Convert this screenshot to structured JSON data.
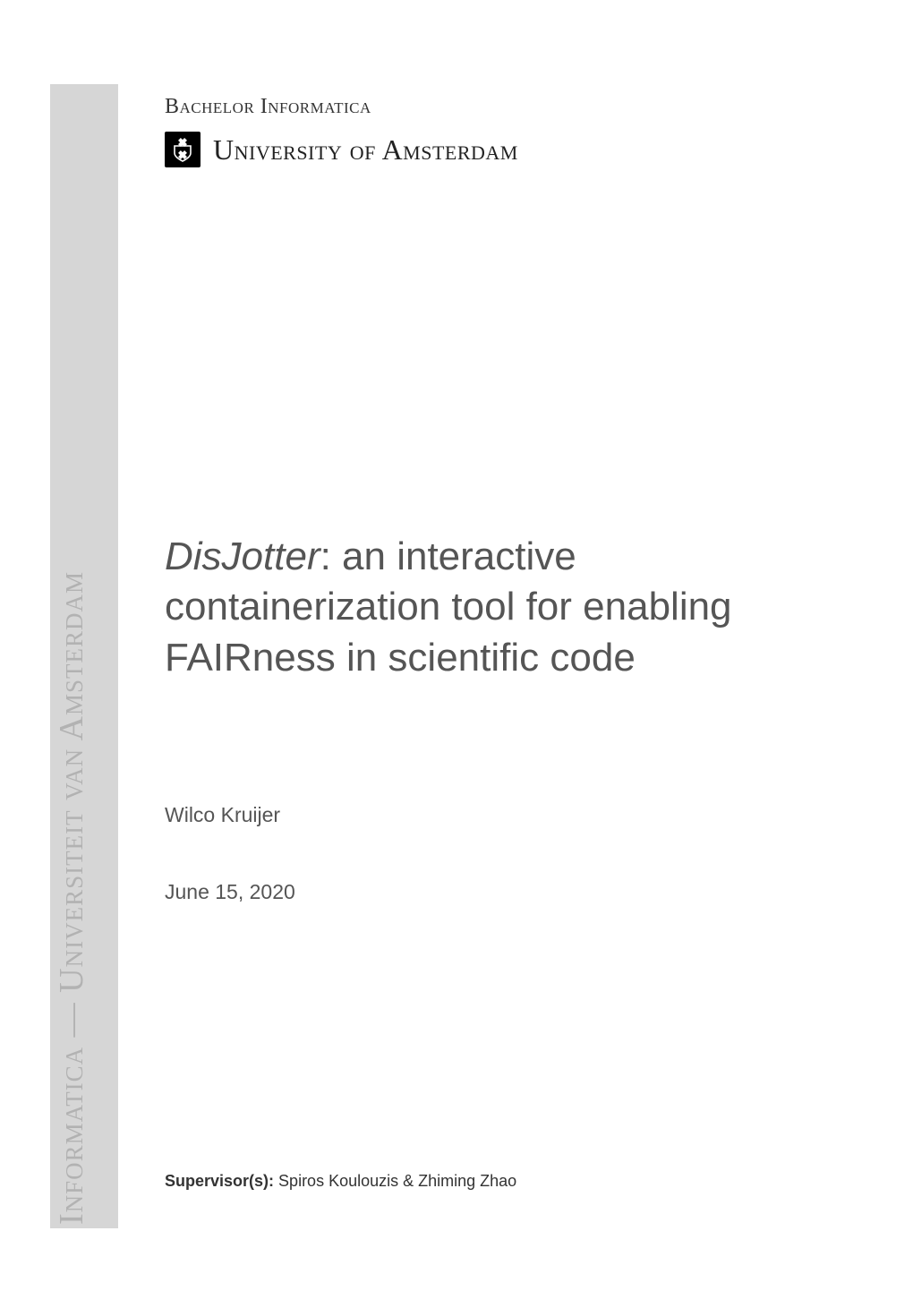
{
  "spine": {
    "text_a": "Informatica",
    "text_sep": " — ",
    "text_b": "Universiteit van Amsterdam"
  },
  "header": {
    "subject": "Bachelor Informatica",
    "university_name": "University of Amsterdam",
    "logo_name": "uva-logo"
  },
  "title": {
    "emph": "DisJotter",
    "rest": ": an interactive containerization tool for enabling FAIRness in scientific code"
  },
  "author": "Wilco Kruijer",
  "date": "June 15, 2020",
  "supervisor": {
    "label": "Supervisor(s):",
    "names": "Spiros Koulouzis & Zhiming Zhao"
  }
}
